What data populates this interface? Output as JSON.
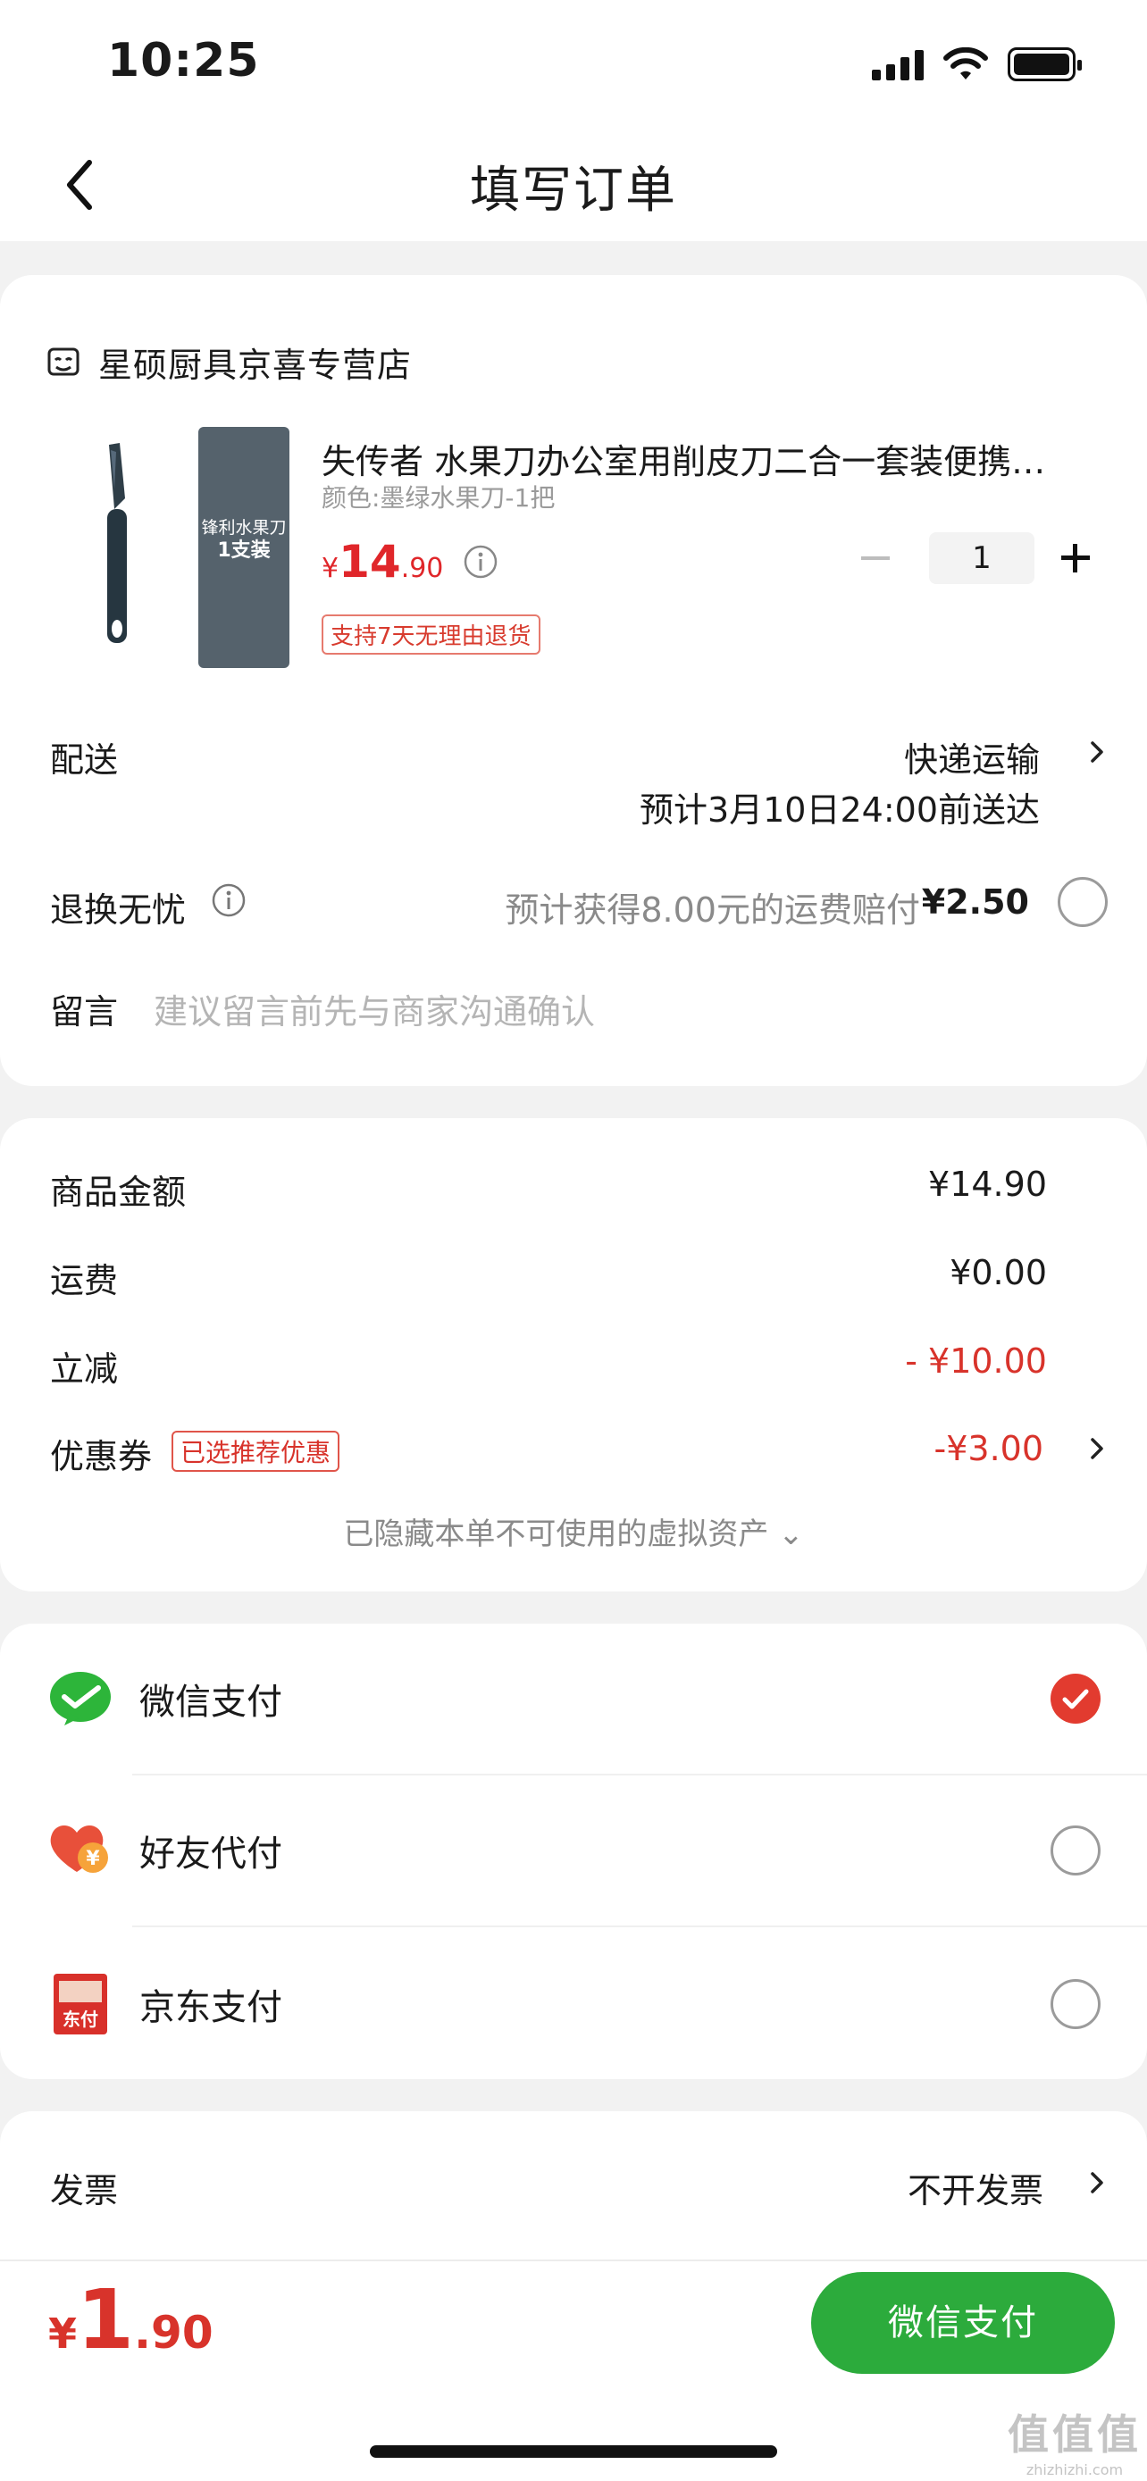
{
  "status_bar": {
    "time": "10:25"
  },
  "nav": {
    "title": "填写订单"
  },
  "store": {
    "name": "星硕厨具京喜专营店"
  },
  "product": {
    "title": "失传者 水果刀办公室用削皮刀二合一套装便携…",
    "spec": "颜色:墨绿水果刀-1把",
    "price_symbol": "¥",
    "price_int": "14",
    "price_dec": ".90",
    "quantity": "1",
    "return_badge": "支持7天无理由退货",
    "image_label_line1": "锋利水果刀",
    "image_label_line2": "1支装"
  },
  "delivery": {
    "label": "配送",
    "method": "快递运输",
    "eta": "预计3月10日24:00前送达"
  },
  "hassle_free": {
    "label": "退换无忧",
    "text": "预计获得8.00元的运费赔付",
    "price": "¥2.50",
    "selected": false
  },
  "message": {
    "label": "留言",
    "placeholder": "建议留言前先与商家沟通确认"
  },
  "amounts": {
    "goods_label": "商品金额",
    "goods_value": "¥14.90",
    "shipping_label": "运费",
    "shipping_value": "¥0.00",
    "discount_label": "立减",
    "discount_value": "- ¥10.00",
    "coupon_label": "优惠券",
    "coupon_tag": "已选推荐优惠",
    "coupon_value": "-¥3.00",
    "hidden_note": "已隐藏本单不可使用的虚拟资产 ⌄"
  },
  "payment": {
    "options": [
      {
        "label": "微信支付",
        "icon": "wechat-pay-icon",
        "selected": true
      },
      {
        "label": "好友代付",
        "icon": "friend-pay-icon",
        "selected": false
      },
      {
        "label": "京东支付",
        "icon": "jd-pay-icon",
        "selected": false
      }
    ],
    "jd_icon_text": "东付",
    "friend_icon_text": "¥"
  },
  "invoice": {
    "label": "发票",
    "value": "不开发票"
  },
  "footer": {
    "total_symbol": "¥",
    "total_int": "1",
    "total_dec": ".90",
    "pay_button": "微信支付"
  },
  "watermark": {
    "main": "值值值",
    "sub": "zhizhizhi.com"
  },
  "colors": {
    "accent_red": "#d8332b",
    "pay_green": "#2cab3c"
  }
}
